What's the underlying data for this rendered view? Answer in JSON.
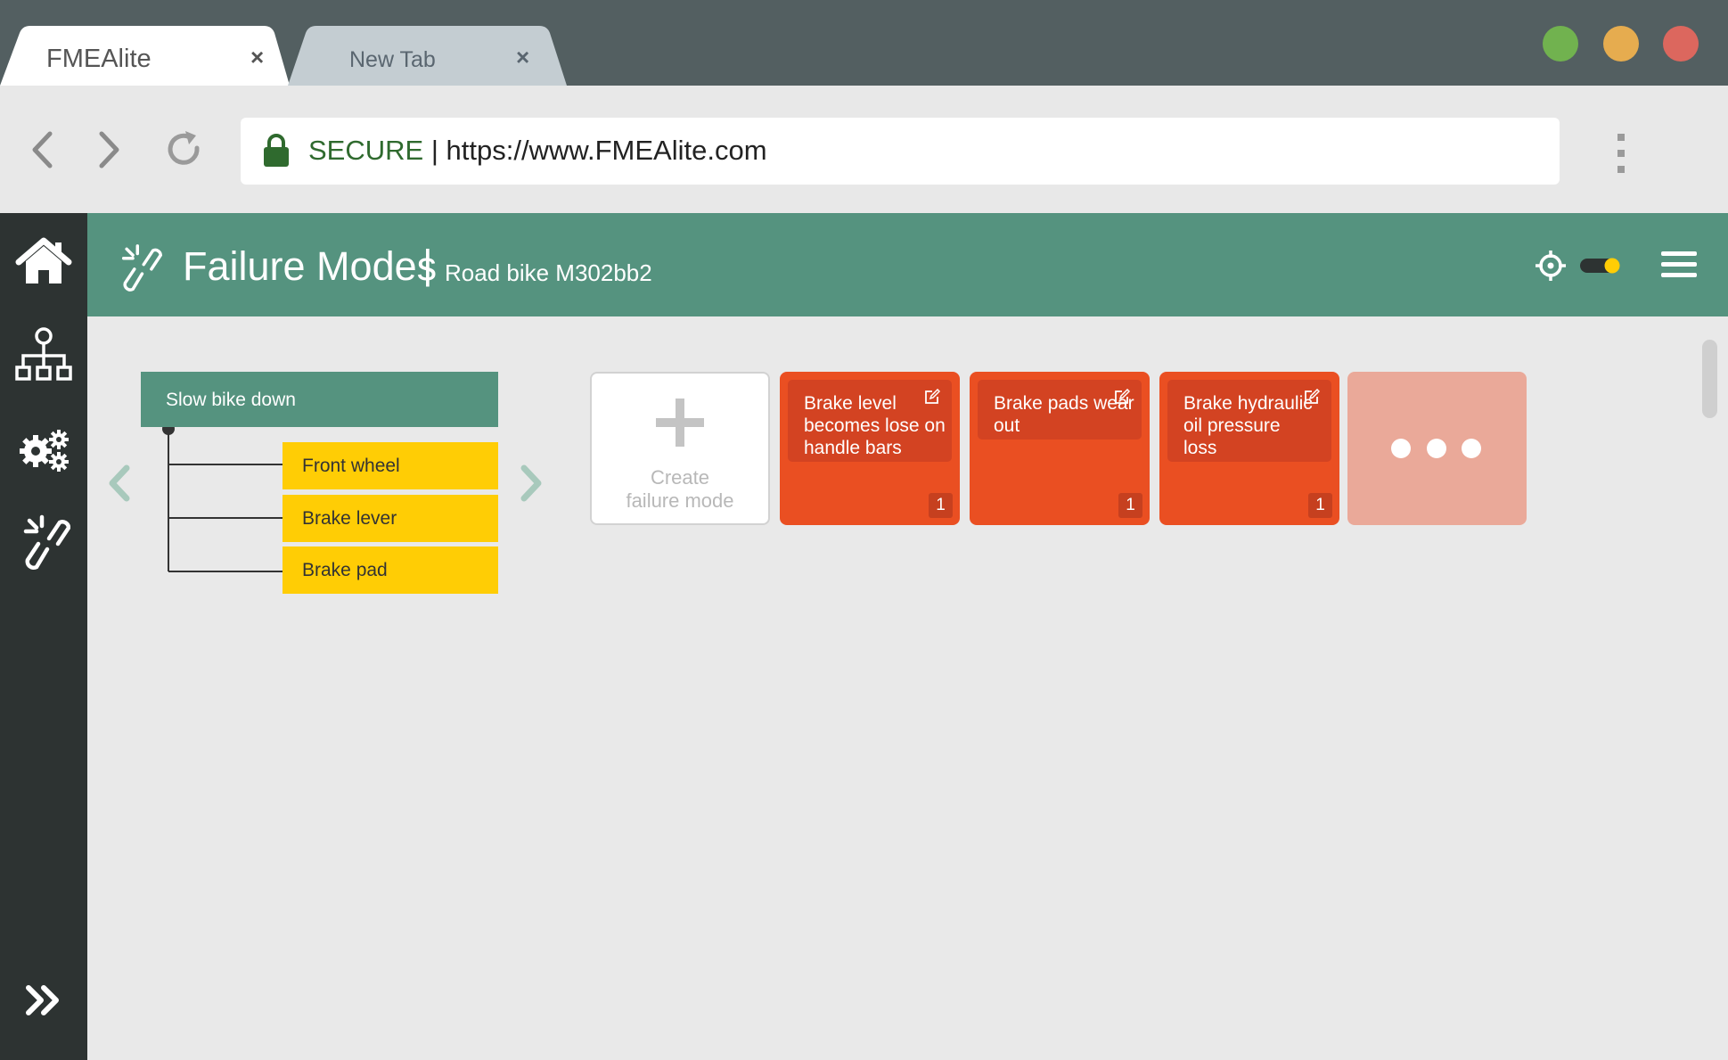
{
  "browser": {
    "tabs": [
      {
        "title": "FMEAlite",
        "close": "×"
      },
      {
        "title": "New Tab",
        "close": "×"
      }
    ],
    "window_controls": {
      "colors": [
        "#71b24f",
        "#e6ac4f",
        "#dc675e"
      ]
    },
    "address": {
      "secure_label": "SECURE",
      "separator": "|",
      "url": "https://www.FMEAlite.com"
    }
  },
  "sidebar": {
    "items": [
      {
        "icon": "home-icon"
      },
      {
        "icon": "hierarchy-icon"
      },
      {
        "icon": "gears-icon"
      },
      {
        "icon": "broken-link-icon"
      }
    ],
    "expand_icon": "double-chevron-right-icon"
  },
  "header": {
    "icon": "broken-link-icon",
    "title": "Failure Modes",
    "separator": "|",
    "subtitle": "Road bike M302bb2",
    "right_icons": [
      "crosshair-icon",
      "toggle-switch",
      "hamburger-menu-icon"
    ]
  },
  "tree": {
    "function": "Slow bike down",
    "components": [
      "Front wheel",
      "Brake lever",
      "Brake pad"
    ]
  },
  "cards": {
    "create_label": "Create\nfailure mode",
    "failure_modes": [
      {
        "label": "Brake level becomes lose on handle bars",
        "count": "1"
      },
      {
        "label": "Brake pads wear out",
        "count": "1"
      },
      {
        "label": "Brake hydraulic oil pressure loss",
        "count": "1"
      }
    ]
  },
  "colors": {
    "header": "#55937f",
    "sidebar": "#2d3332",
    "component": "#ffcd05",
    "failure_mode": "#ea4f22",
    "more": "#eaa999"
  }
}
